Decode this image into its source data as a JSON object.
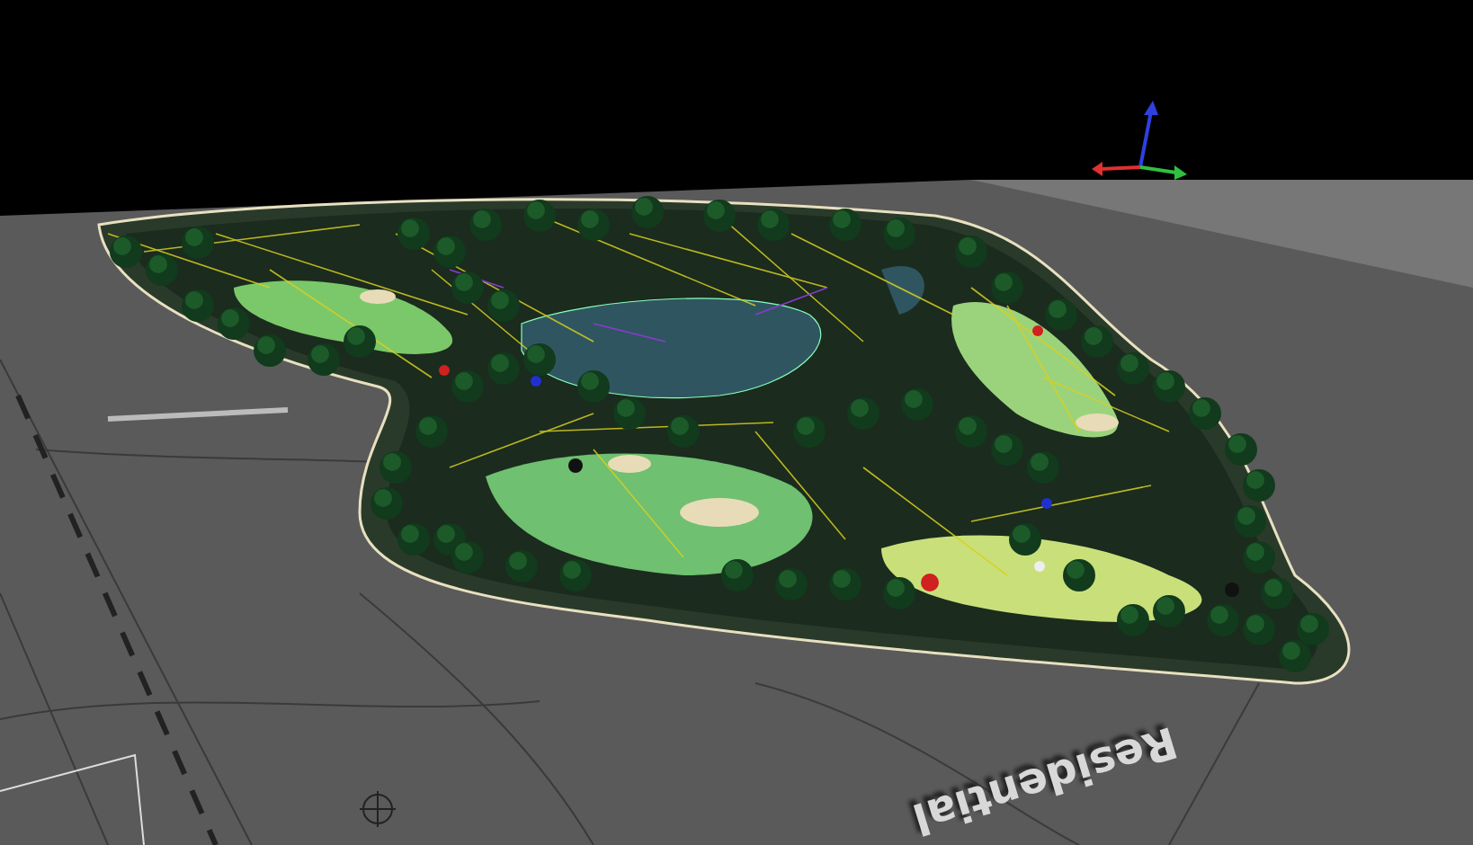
{
  "viewport": {
    "map_labels": [
      {
        "text": "Residential"
      }
    ]
  }
}
